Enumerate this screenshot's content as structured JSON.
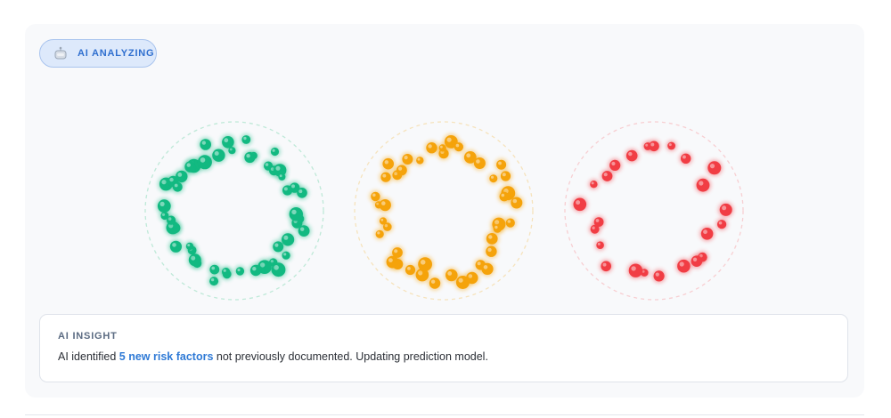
{
  "badge": {
    "label": "AI ANALYZING",
    "icon": "robot-icon"
  },
  "insight": {
    "title": "AI INSIGHT",
    "text_before": "AI identified ",
    "highlight": "5 new risk factors",
    "text_after": " not previously documented. Updating prediction model."
  },
  "clusters": [
    {
      "name": "green-cluster",
      "color": "#12b981",
      "ring_color": "#bfe9d8",
      "dot_count": 48
    },
    {
      "name": "orange-cluster",
      "color": "#f5a30b",
      "ring_color": "#f6e3bd",
      "dot_count": 42
    },
    {
      "name": "red-cluster",
      "color": "#f13d44",
      "ring_color": "#f7cfd2",
      "dot_count": 24
    }
  ]
}
